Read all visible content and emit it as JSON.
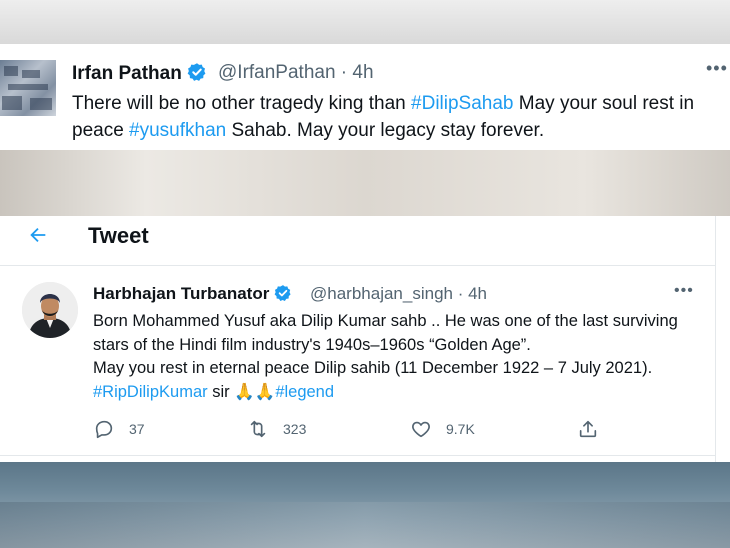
{
  "tweet1": {
    "name": "Irfan Pathan",
    "handle": "@IrfanPathan",
    "time": "4h",
    "text_a": "There will be no other tragedy king than ",
    "tag_a": "#DilipSahab",
    "text_b": " May your soul rest in peace ",
    "tag_b": "#yusufkhan",
    "text_c": " Sahab. May your legacy stay forever.",
    "more": "•••",
    "icons": [
      "verified-badge-icon",
      "more-options-icon"
    ]
  },
  "header": {
    "title": "Tweet",
    "back_icon": "arrow-left-icon"
  },
  "tweet2": {
    "name": "Harbhajan Turbanator",
    "handle": "@harbhajan_singh",
    "time": "4h",
    "text_a": "Born Mohammed Yusuf aka Dilip Kumar sahb .. He was one of the last surviving stars of the Hindi film industry's 1940s–1960s “Golden Age”.\nMay you rest in eternal peace Dilip sahib (11 December 1922 – 7 July 2021).\n",
    "tag_a": "#RipDilipKumar",
    "text_b": " sir ",
    "emoji": "🙏🙏",
    "tag_b": "#legend",
    "more": "•••",
    "actions": {
      "reply_count": "37",
      "retweet_count": "323",
      "like_count": "9.7K"
    },
    "icons": [
      "verified-badge-icon",
      "reply-icon",
      "retweet-icon",
      "like-icon",
      "share-icon"
    ]
  },
  "colors": {
    "link": "#1d9bf0",
    "secondary_text": "#536471",
    "primary_text": "#0f1419"
  }
}
